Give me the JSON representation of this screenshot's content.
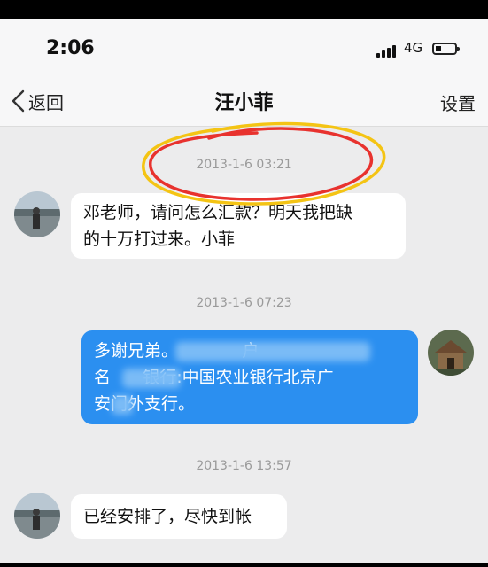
{
  "status_bar": {
    "time": "2:06",
    "network": "4G"
  },
  "nav": {
    "back_label": "返回",
    "title": "汪小菲",
    "settings_label": "设置"
  },
  "messages": [
    {
      "timestamp": "2013-1-6 03:21",
      "direction": "incoming",
      "text": "邓老师，请问怎么汇款？明天我把缺\n的十万打过来。小菲"
    },
    {
      "timestamp": "2013-1-6 07:23",
      "direction": "outgoing",
      "text": "多谢兄弟。            户\n名      银行:中国农业银行北京广\n安门外支行。"
    },
    {
      "timestamp": "2013-1-6 13:57",
      "direction": "incoming",
      "text": "已经安排了，尽快到帐"
    }
  ],
  "colors": {
    "outgoing_bubble": "#2b8ff0",
    "incoming_bubble": "#ffffff",
    "annotation_red": "#e8322e",
    "annotation_yellow": "#f4c414"
  }
}
